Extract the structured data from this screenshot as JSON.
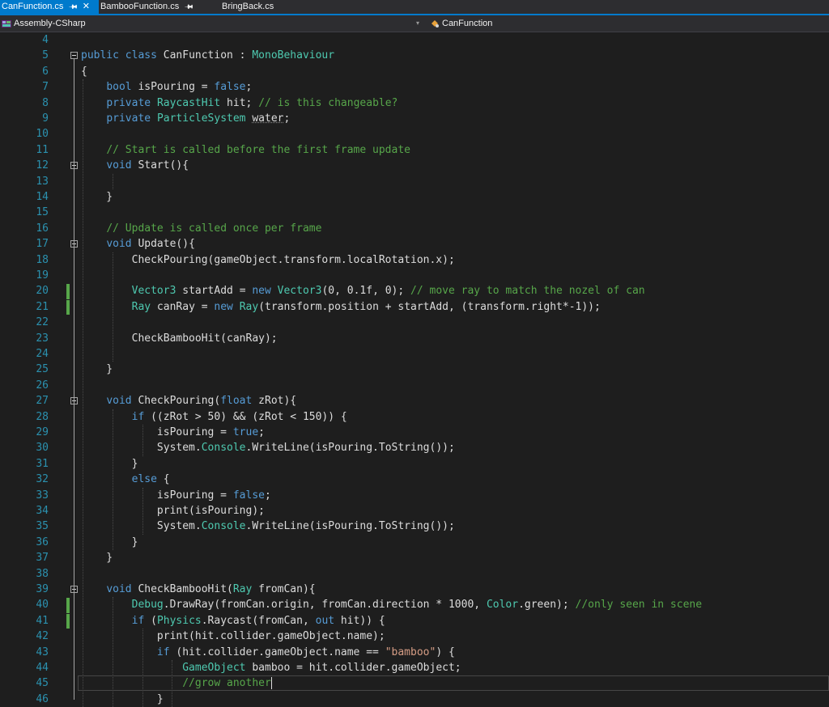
{
  "tabs": [
    {
      "label": "CanFunction.cs",
      "active": true,
      "pinned": true,
      "closable": true
    },
    {
      "label": "BambooFunction.cs",
      "active": false,
      "pinned": true,
      "closable": false
    },
    {
      "label": "BringBack.cs",
      "active": false,
      "pinned": false,
      "closable": false
    }
  ],
  "navbar": {
    "project": "Assembly-CSharp",
    "member": "CanFunction"
  },
  "editor": {
    "first_line": 4,
    "last_line": 46,
    "changed_lines": [
      20,
      21,
      40,
      41
    ],
    "current_line": 45,
    "lines": [
      "",
      "public class CanFunction : MonoBehaviour",
      "{",
      "    bool isPouring = false;",
      "    private RaycastHit hit; // is this changeable?",
      "    private ParticleSystem water;",
      "",
      "    // Start is called before the first frame update",
      "    void Start(){",
      "",
      "    }",
      "",
      "    // Update is called once per frame",
      "    void Update(){",
      "        CheckPouring(gameObject.transform.localRotation.x);",
      "",
      "        Vector3 startAdd = new Vector3(0, 0.1f, 0); // move ray to match the nozel of can",
      "        Ray canRay = new Ray(transform.position + startAdd, (transform.right*-1));",
      "",
      "        CheckBambooHit(canRay);",
      "",
      "    }",
      "",
      "    void CheckPouring(float zRot){",
      "        if ((zRot > 50) && (zRot < 150)) {",
      "            isPouring = true;",
      "            System.Console.WriteLine(isPouring.ToString());",
      "        }",
      "        else {",
      "            isPouring = false;",
      "            print(isPouring);",
      "            System.Console.WriteLine(isPouring.ToString());",
      "        }",
      "    }",
      "",
      "    void CheckBambooHit(Ray fromCan){",
      "        Debug.DrawRay(fromCan.origin, fromCan.direction * 1000, Color.green); //only seen in scene",
      "        if (Physics.Raycast(fromCan, out hit)) {",
      "            print(hit.collider.gameObject.name);",
      "            if (hit.collider.gameObject.name == \"bamboo\") {",
      "                GameObject bamboo = hit.collider.gameObject;",
      "                //grow another",
      "            }"
    ]
  },
  "colors": {
    "background": "#1e1e1e",
    "keyword": "#569cd6",
    "type": "#4ec9b0",
    "comment": "#57a64a",
    "string": "#d69d85",
    "number": "#b5cea8",
    "line_number": "#2b91af",
    "tab_active": "#007acc"
  }
}
